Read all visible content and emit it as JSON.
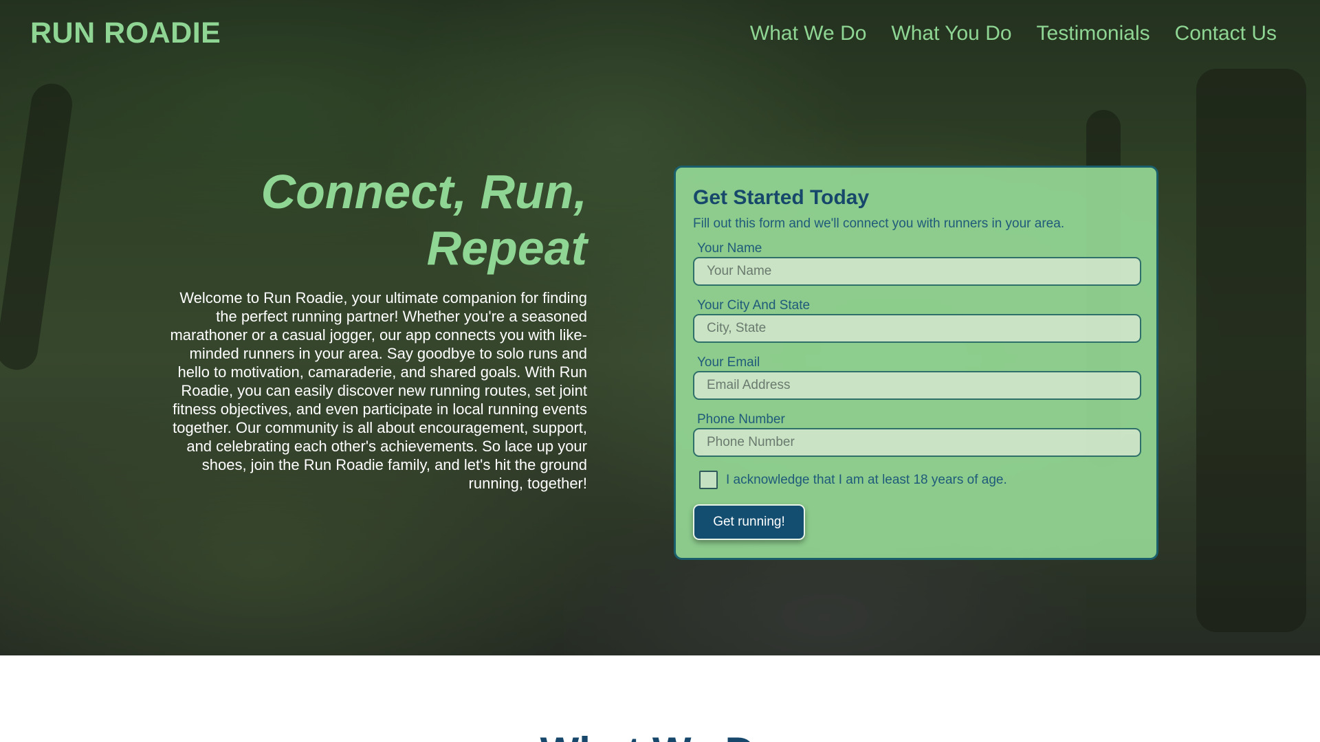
{
  "header": {
    "logo": "RUN ROADIE",
    "nav": [
      "What We Do",
      "What You Do",
      "Testimonials",
      "Contact Us"
    ]
  },
  "hero": {
    "title": "Connect, Run, Repeat",
    "text": "Welcome to Run Roadie, your ultimate companion for finding the perfect running partner! Whether you're a seasoned marathoner or a casual jogger, our app connects you with like-minded runners in your area. Say goodbye to solo runs and hello to motivation, camaraderie, and shared goals. With Run Roadie, you can easily discover new running routes, set joint fitness objectives, and even participate in local running events together. Our community is all about encouragement, support, and celebrating each other's achievements. So lace up your shoes, join the Run Roadie family, and let's hit the ground running, together!"
  },
  "form": {
    "title": "Get Started Today",
    "subtitle": "Fill out this form and we'll connect you with runners in your area.",
    "fields": [
      {
        "label": "Your Name",
        "placeholder": "Your Name",
        "value": ""
      },
      {
        "label": "Your City And State",
        "placeholder": "City, State",
        "value": ""
      },
      {
        "label": "Your Email",
        "placeholder": "Email Address",
        "value": ""
      },
      {
        "label": "Phone Number",
        "placeholder": "Phone Number",
        "value": ""
      }
    ],
    "acknowledge": {
      "label": "I acknowledge that I am at least 18 years of age.",
      "checked": false
    },
    "submit_label": "Get running!"
  },
  "next_section": {
    "title": "What We Do"
  },
  "colors": {
    "accent_green": "#8fd694",
    "navy": "#134e70",
    "form_bg": "#93d693"
  }
}
